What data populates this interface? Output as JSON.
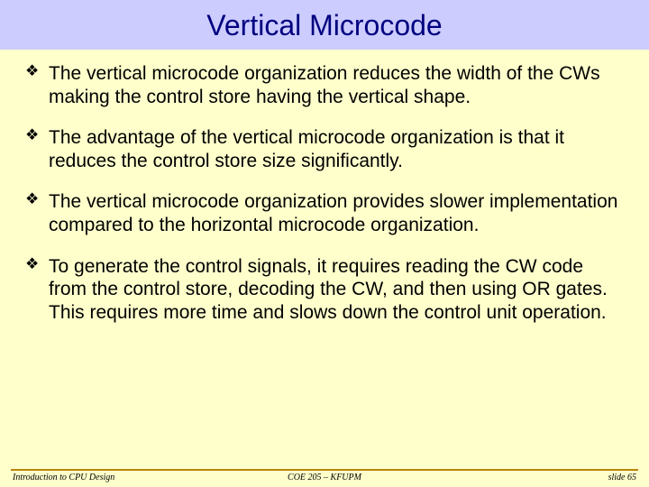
{
  "title": "Vertical Microcode",
  "bullets": [
    "The vertical microcode organization reduces the width of the CWs making the control store having the vertical shape.",
    " The advantage of the vertical microcode organization is that it reduces the control store size significantly.",
    "The vertical microcode organization provides slower implementation compared to the horizontal microcode organization.",
    "To generate the control signals, it requires reading the CW code from the control store, decoding the CW, and then using OR gates. This requires more time and slows down the control unit operation."
  ],
  "footer": {
    "left": "Introduction to CPU Design",
    "center": "COE 205 – KFUPM",
    "right": "slide 65"
  }
}
